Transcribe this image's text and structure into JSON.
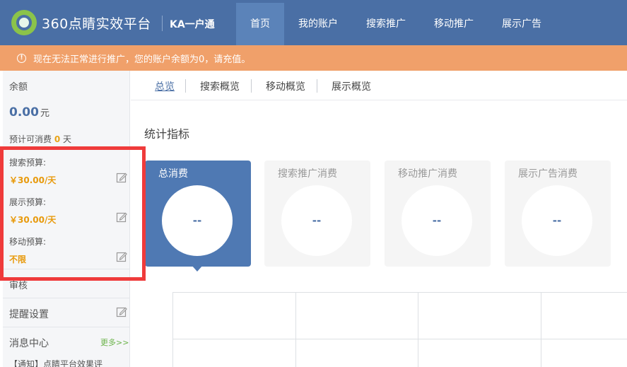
{
  "header": {
    "logo_text": "360点睛实效平台",
    "sub_title": "KA一户通",
    "nav": [
      {
        "label": "首页",
        "active": true
      },
      {
        "label": "我的账户",
        "active": false
      },
      {
        "label": "搜索推广",
        "active": false
      },
      {
        "label": "移动推广",
        "active": false
      },
      {
        "label": "展示广告",
        "active": false
      }
    ]
  },
  "alert": {
    "icon": "exclamation-circle-icon",
    "text": "现在无法正常进行推广，您的账户余额为0，请充值。"
  },
  "sidebar": {
    "balance_label": "余额",
    "balance_value": "0.00",
    "balance_unit": "元",
    "forecast_prefix": "预计可消费",
    "forecast_days": "0",
    "forecast_suffix": "天",
    "search_budget_label": "搜索预算:",
    "search_budget_value": "￥30.00/天",
    "display_budget_label": "展示预算:",
    "display_budget_value": "￥30.00/天",
    "mobile_budget_label": "移动预算:",
    "mobile_budget_value": "不限",
    "review_label": "审核",
    "reminder_label": "提醒设置",
    "message_label": "消息中心",
    "more_link": "更多>>",
    "notice_text": "【通知】点睛平台效果评"
  },
  "main": {
    "tabs": [
      "总览",
      "搜索概览",
      "移动概览",
      "展示概览"
    ],
    "section_title": "统计指标",
    "cards": [
      {
        "title": "总消费",
        "value": "--"
      },
      {
        "title": "搜索推广消费",
        "value": "--"
      },
      {
        "title": "移动推广消费",
        "value": "--"
      },
      {
        "title": "展示广告消费",
        "value": "--"
      }
    ]
  },
  "colors": {
    "header_bg": "#4a6fa5",
    "alert_bg": "#f0a06a",
    "budget_value": "#e89a0c",
    "annotation_box": "#ef3b3b"
  }
}
